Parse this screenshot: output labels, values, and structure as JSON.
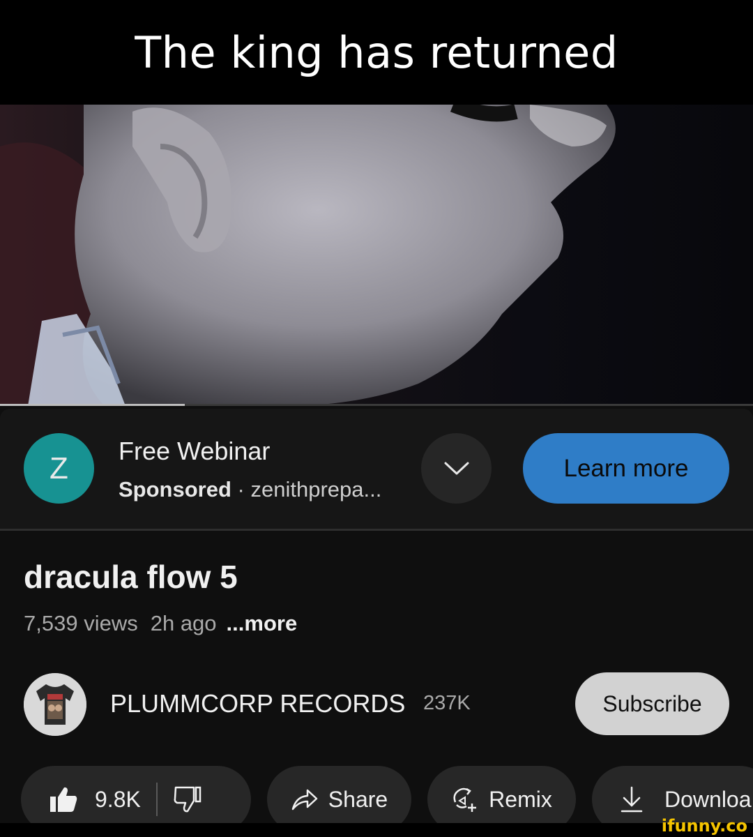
{
  "caption": "The king has returned",
  "video": {
    "progress_fraction": 0.245
  },
  "ad": {
    "avatar_letter": "Z",
    "title": "Free Webinar",
    "sponsored": "Sponsored",
    "separator": "·",
    "domain": "zenithprepa...",
    "cta": "Learn more",
    "accent": "#2f7dc7",
    "avatar_color": "#179292"
  },
  "video_info": {
    "title": "dracula flow 5",
    "views": "7,539 views",
    "age": "2h ago",
    "more": "...more"
  },
  "channel": {
    "name": "PLUMMCORP RECORDS",
    "subscribers": "237K",
    "subscribe_label": "Subscribe"
  },
  "actions": {
    "likes": "9.8K",
    "share": "Share",
    "remix": "Remix",
    "download": "Downloa"
  },
  "watermark": "ifunny.co",
  "icons": [
    "chevron-down-icon",
    "thumbs-up-icon",
    "thumbs-down-icon",
    "share-arrow-icon",
    "remix-icon",
    "download-icon"
  ]
}
